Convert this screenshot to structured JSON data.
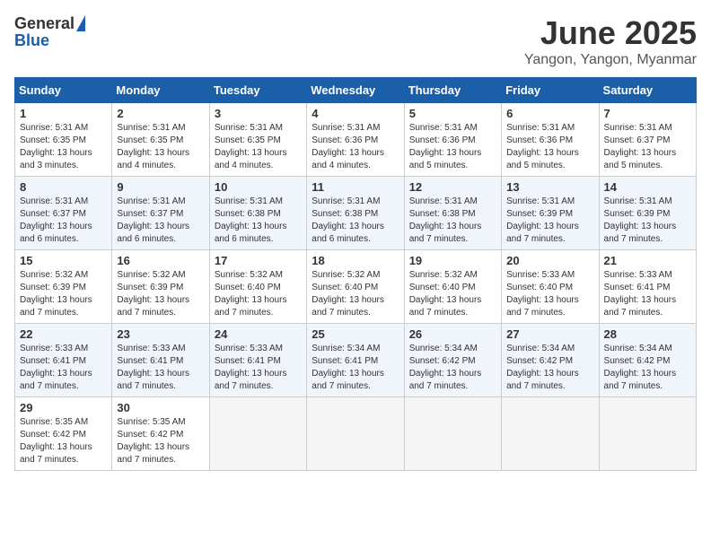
{
  "logo": {
    "general": "General",
    "blue": "Blue"
  },
  "title": "June 2025",
  "location": "Yangon, Yangon, Myanmar",
  "days_of_week": [
    "Sunday",
    "Monday",
    "Tuesday",
    "Wednesday",
    "Thursday",
    "Friday",
    "Saturday"
  ],
  "weeks": [
    [
      {
        "day": "1",
        "sunrise": "5:31 AM",
        "sunset": "6:35 PM",
        "daylight": "13 hours and 3 minutes."
      },
      {
        "day": "2",
        "sunrise": "5:31 AM",
        "sunset": "6:35 PM",
        "daylight": "13 hours and 4 minutes."
      },
      {
        "day": "3",
        "sunrise": "5:31 AM",
        "sunset": "6:35 PM",
        "daylight": "13 hours and 4 minutes."
      },
      {
        "day": "4",
        "sunrise": "5:31 AM",
        "sunset": "6:36 PM",
        "daylight": "13 hours and 4 minutes."
      },
      {
        "day": "5",
        "sunrise": "5:31 AM",
        "sunset": "6:36 PM",
        "daylight": "13 hours and 5 minutes."
      },
      {
        "day": "6",
        "sunrise": "5:31 AM",
        "sunset": "6:36 PM",
        "daylight": "13 hours and 5 minutes."
      },
      {
        "day": "7",
        "sunrise": "5:31 AM",
        "sunset": "6:37 PM",
        "daylight": "13 hours and 5 minutes."
      }
    ],
    [
      {
        "day": "8",
        "sunrise": "5:31 AM",
        "sunset": "6:37 PM",
        "daylight": "13 hours and 6 minutes."
      },
      {
        "day": "9",
        "sunrise": "5:31 AM",
        "sunset": "6:37 PM",
        "daylight": "13 hours and 6 minutes."
      },
      {
        "day": "10",
        "sunrise": "5:31 AM",
        "sunset": "6:38 PM",
        "daylight": "13 hours and 6 minutes."
      },
      {
        "day": "11",
        "sunrise": "5:31 AM",
        "sunset": "6:38 PM",
        "daylight": "13 hours and 6 minutes."
      },
      {
        "day": "12",
        "sunrise": "5:31 AM",
        "sunset": "6:38 PM",
        "daylight": "13 hours and 7 minutes."
      },
      {
        "day": "13",
        "sunrise": "5:31 AM",
        "sunset": "6:39 PM",
        "daylight": "13 hours and 7 minutes."
      },
      {
        "day": "14",
        "sunrise": "5:31 AM",
        "sunset": "6:39 PM",
        "daylight": "13 hours and 7 minutes."
      }
    ],
    [
      {
        "day": "15",
        "sunrise": "5:32 AM",
        "sunset": "6:39 PM",
        "daylight": "13 hours and 7 minutes."
      },
      {
        "day": "16",
        "sunrise": "5:32 AM",
        "sunset": "6:39 PM",
        "daylight": "13 hours and 7 minutes."
      },
      {
        "day": "17",
        "sunrise": "5:32 AM",
        "sunset": "6:40 PM",
        "daylight": "13 hours and 7 minutes."
      },
      {
        "day": "18",
        "sunrise": "5:32 AM",
        "sunset": "6:40 PM",
        "daylight": "13 hours and 7 minutes."
      },
      {
        "day": "19",
        "sunrise": "5:32 AM",
        "sunset": "6:40 PM",
        "daylight": "13 hours and 7 minutes."
      },
      {
        "day": "20",
        "sunrise": "5:33 AM",
        "sunset": "6:40 PM",
        "daylight": "13 hours and 7 minutes."
      },
      {
        "day": "21",
        "sunrise": "5:33 AM",
        "sunset": "6:41 PM",
        "daylight": "13 hours and 7 minutes."
      }
    ],
    [
      {
        "day": "22",
        "sunrise": "5:33 AM",
        "sunset": "6:41 PM",
        "daylight": "13 hours and 7 minutes."
      },
      {
        "day": "23",
        "sunrise": "5:33 AM",
        "sunset": "6:41 PM",
        "daylight": "13 hours and 7 minutes."
      },
      {
        "day": "24",
        "sunrise": "5:33 AM",
        "sunset": "6:41 PM",
        "daylight": "13 hours and 7 minutes."
      },
      {
        "day": "25",
        "sunrise": "5:34 AM",
        "sunset": "6:41 PM",
        "daylight": "13 hours and 7 minutes."
      },
      {
        "day": "26",
        "sunrise": "5:34 AM",
        "sunset": "6:42 PM",
        "daylight": "13 hours and 7 minutes."
      },
      {
        "day": "27",
        "sunrise": "5:34 AM",
        "sunset": "6:42 PM",
        "daylight": "13 hours and 7 minutes."
      },
      {
        "day": "28",
        "sunrise": "5:34 AM",
        "sunset": "6:42 PM",
        "daylight": "13 hours and 7 minutes."
      }
    ],
    [
      {
        "day": "29",
        "sunrise": "5:35 AM",
        "sunset": "6:42 PM",
        "daylight": "13 hours and 7 minutes."
      },
      {
        "day": "30",
        "sunrise": "5:35 AM",
        "sunset": "6:42 PM",
        "daylight": "13 hours and 7 minutes."
      },
      null,
      null,
      null,
      null,
      null
    ]
  ]
}
